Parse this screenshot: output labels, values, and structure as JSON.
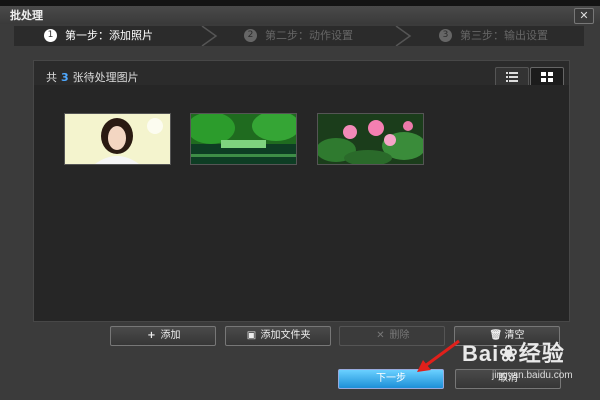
{
  "window": {
    "title": "批处理"
  },
  "steps": [
    {
      "num": "1",
      "label": "第一步：添加照片",
      "state": "active"
    },
    {
      "num": "2",
      "label": "第二步：动作设置",
      "state": "inactive"
    },
    {
      "num": "3",
      "label": "第三步：输出设置",
      "state": "inactive"
    }
  ],
  "panel": {
    "count_prefix": "共",
    "count": "3",
    "count_suffix": "张待处理图片"
  },
  "thumbnails": [
    {
      "name": "portrait-photo"
    },
    {
      "name": "garden-photo"
    },
    {
      "name": "lotus-photo"
    }
  ],
  "actions": {
    "add": "添加",
    "add_folder": "添加文件夹",
    "delete": "删除",
    "clear": "清空"
  },
  "footer": {
    "next": "下一步",
    "cancel": "取消"
  },
  "watermark": {
    "brand": "Bai",
    "brand2": "经验",
    "url": "jingyan.baidu.com"
  },
  "colors": {
    "accent": "#1d8fd8",
    "count": "#4fa9ff"
  }
}
